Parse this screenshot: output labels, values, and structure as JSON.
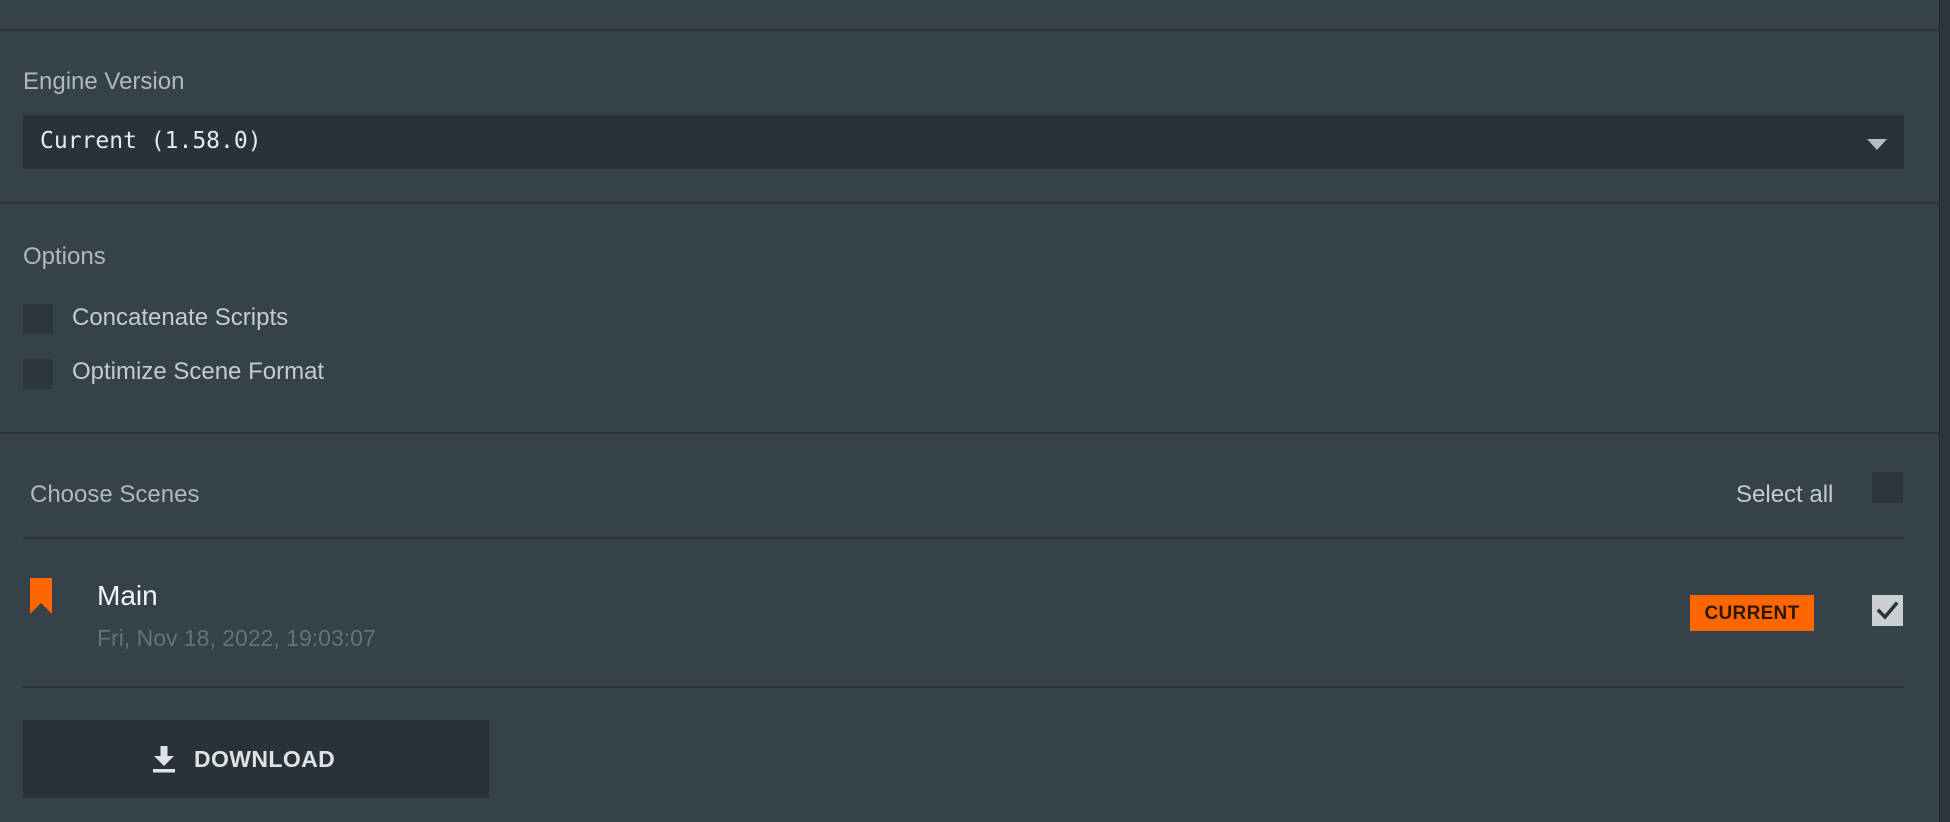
{
  "engine": {
    "label": "Engine Version",
    "selected": "Current (1.58.0)",
    "caret_icon": "caret-down-icon"
  },
  "options": {
    "label": "Options",
    "items": [
      {
        "label": "Concatenate Scripts",
        "checked": false
      },
      {
        "label": "Optimize Scene Format",
        "checked": false
      }
    ]
  },
  "scenes": {
    "label": "Choose Scenes",
    "select_all_label": "Select all",
    "select_all_checked": false,
    "items": [
      {
        "name": "Main",
        "date": "Fri, Nov 18, 2022, 19:03:07",
        "badge": "CURRENT",
        "checked": true,
        "icon": "bookmark-icon"
      }
    ]
  },
  "download": {
    "label": "DOWNLOAD",
    "icon": "download-icon"
  },
  "colors": {
    "background": "#364249",
    "panel": "#283238",
    "accent": "#fd6600",
    "text_muted": "#66727a"
  }
}
